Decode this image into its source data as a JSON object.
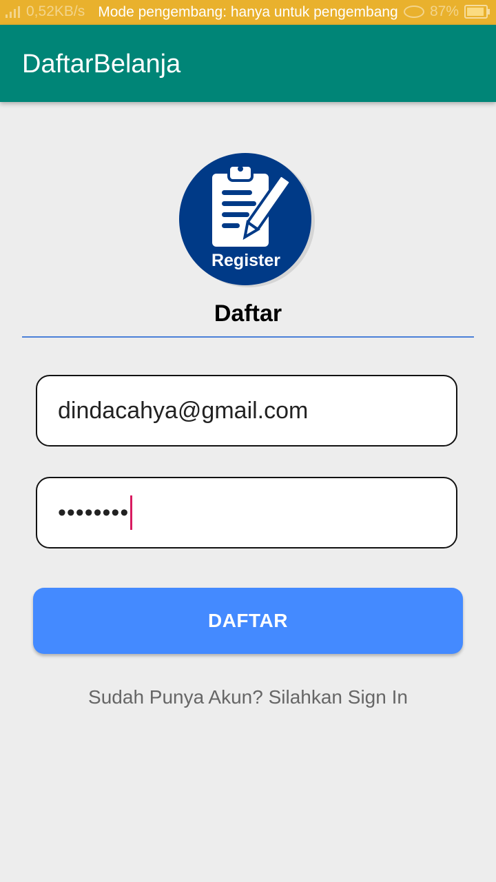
{
  "status_bar": {
    "speed": "0,52KB/s",
    "dev_mode_text": "Mode pengembang: hanya untuk pengembang",
    "battery": "87%"
  },
  "app_bar": {
    "title": "DaftarBelanja"
  },
  "logo": {
    "icon": "clipboard-pen-icon",
    "label": "Register",
    "color": "#003a87"
  },
  "form": {
    "heading": "Daftar",
    "email_value": "dindacahya@gmail.com",
    "password_value": "••••••••",
    "submit_label": "DAFTAR",
    "signin_text": "Sudah Punya Akun? Silahkan Sign In"
  },
  "colors": {
    "status_bar": "#e9b12d",
    "app_bar": "#008577",
    "button": "#448aff",
    "divider": "#4a7fd8"
  }
}
